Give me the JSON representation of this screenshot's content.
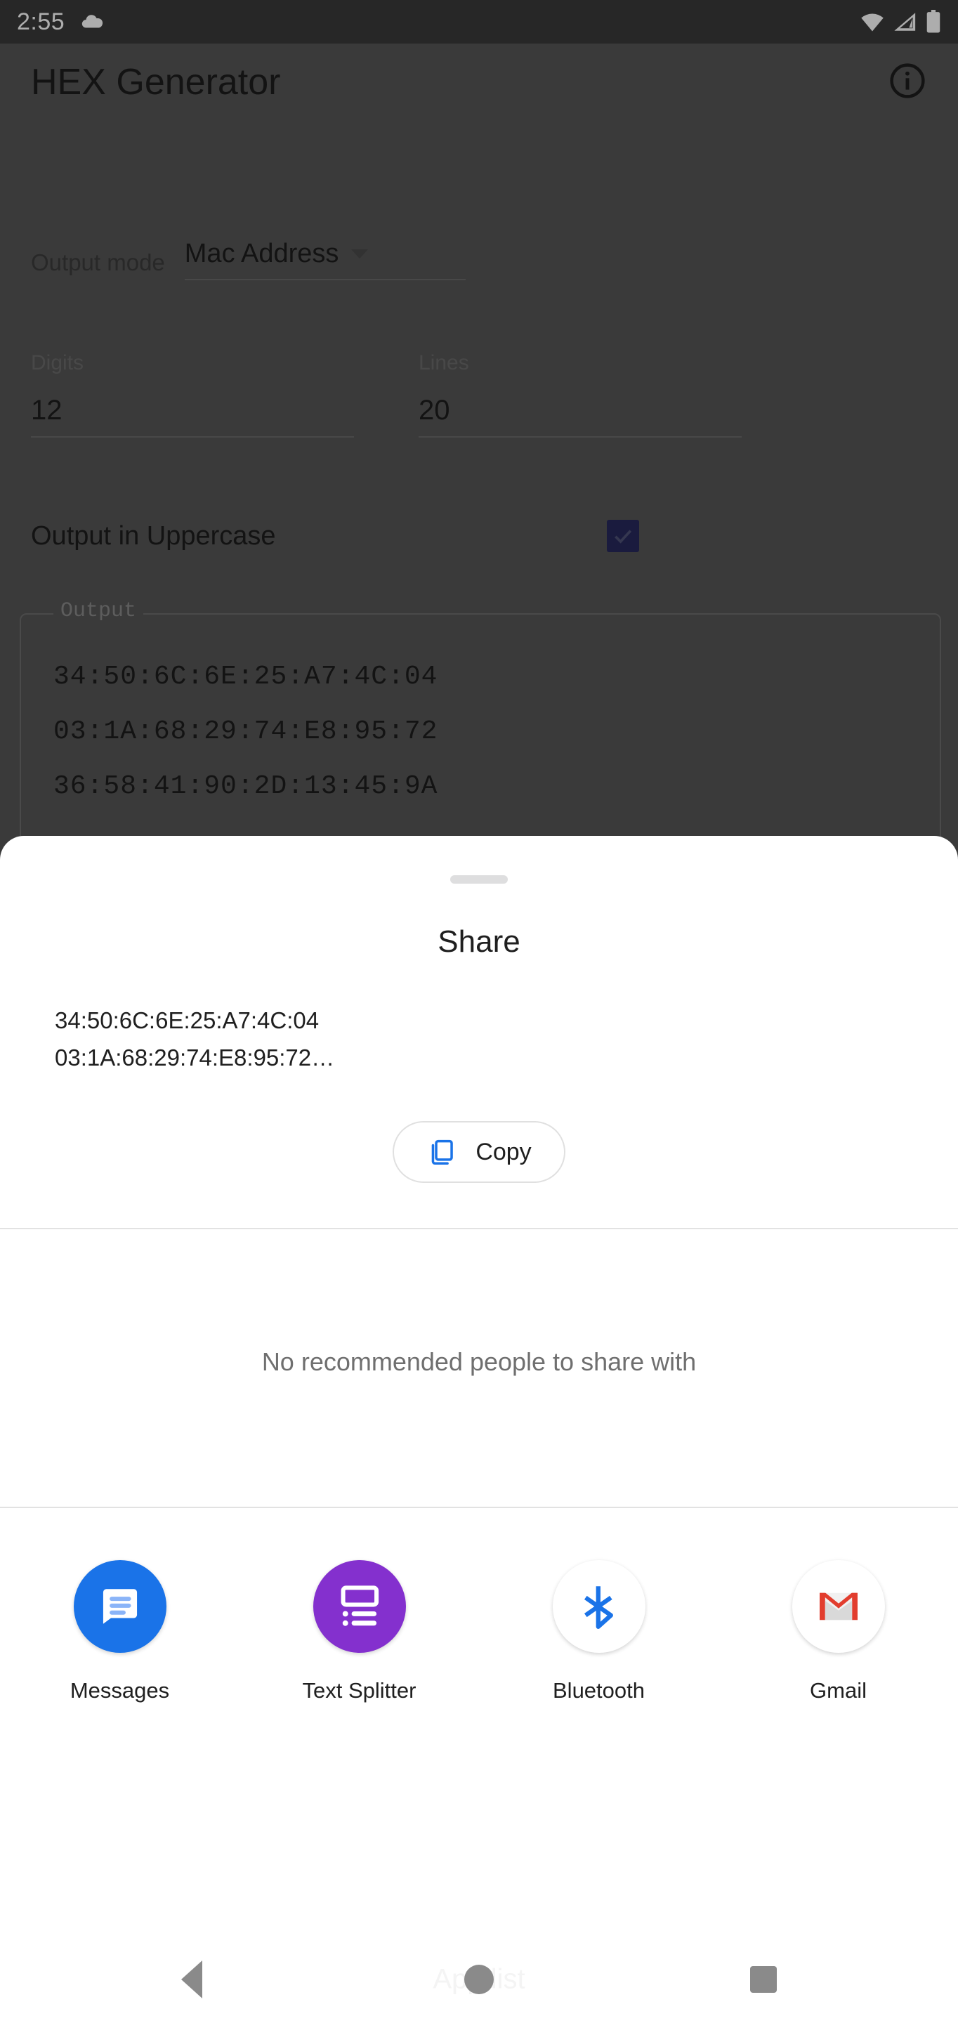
{
  "status_bar": {
    "clock": "2:55",
    "icons": [
      "cloud-icon",
      "wifi-icon",
      "signal-icon",
      "battery-icon"
    ]
  },
  "app": {
    "title": "HEX Generator",
    "info_icon": "info-icon",
    "output_mode": {
      "label": "Output mode",
      "value": "Mac Address",
      "caret_icon": "chevron-down-icon"
    },
    "digits": {
      "label": "Digits",
      "value": "12"
    },
    "lines": {
      "label": "Lines",
      "value": "20"
    },
    "uppercase": {
      "label": "Output in Uppercase",
      "checked": true,
      "check_icon": "check-icon"
    },
    "output": {
      "legend": "Output",
      "lines": [
        "34:50:6C:6E:25:A7:4C:04",
        "03:1A:68:29:74:E8:95:72",
        "36:58:41:90:2D:13:45:9A"
      ]
    }
  },
  "share_sheet": {
    "handle": "drag-handle",
    "title": "Share",
    "preview_line_1": "34:50:6C:6E:25:A7:4C:04",
    "preview_line_2": "03:1A:68:29:74:E8:95:72…",
    "copy_button": {
      "label": "Copy",
      "icon": "copy-icon",
      "icon_color": "#1a73e8"
    },
    "no_people_text": "No recommended people to share with",
    "targets": [
      {
        "name": "Messages",
        "icon": "messages-icon",
        "bg": "#1a73e8"
      },
      {
        "name": "Text Splitter",
        "icon": "text-splitter-icon",
        "bg": "#8430ce"
      },
      {
        "name": "Bluetooth",
        "icon": "bluetooth-icon",
        "bg": "#ffffff"
      },
      {
        "name": "Gmail",
        "icon": "gmail-icon",
        "bg": "#ffffff"
      }
    ]
  },
  "nav_bar": {
    "hint_text": "App list",
    "back": "back-button",
    "home": "home-button",
    "recents": "recents-button"
  },
  "colors": {
    "accent_blue": "#1a73e8",
    "scrim": "rgba(0,0,0,0.32)",
    "status_bar_bg": "#3a3a3a",
    "sheet_bg": "#ffffff"
  }
}
